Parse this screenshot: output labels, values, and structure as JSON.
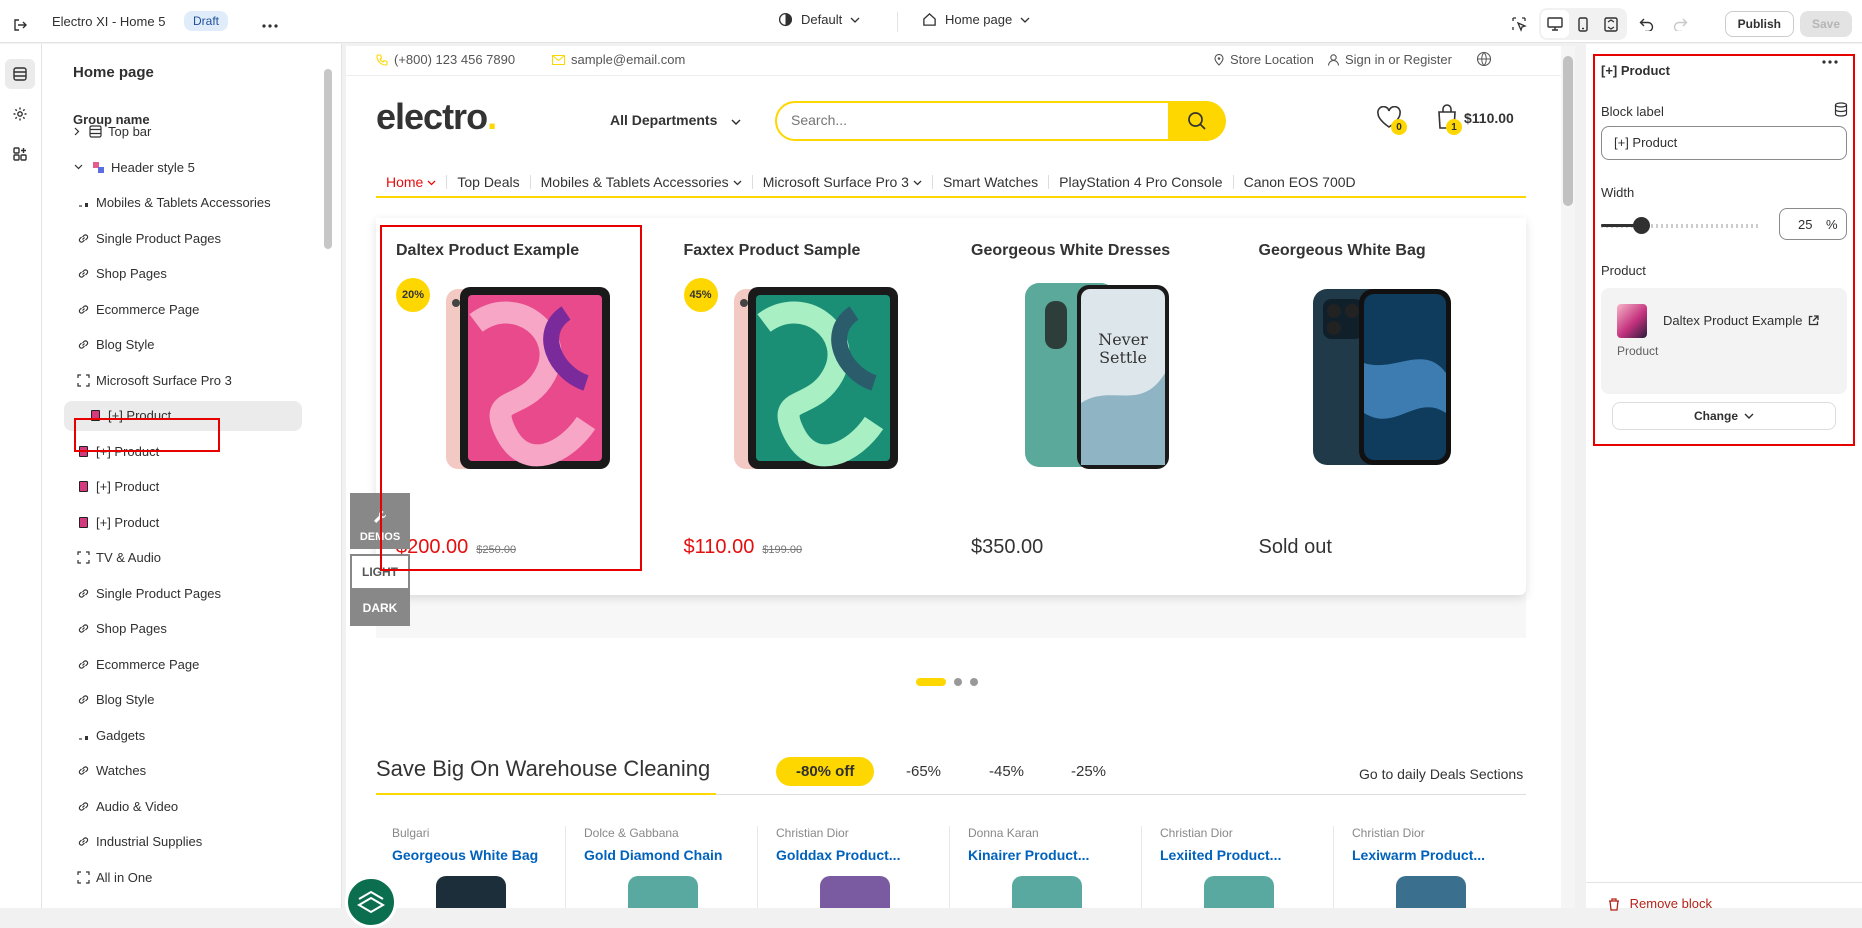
{
  "topbar": {
    "title": "Electro XI - Home 5",
    "status_badge": "Draft",
    "theme_selector": "Default",
    "page_selector": "Home page",
    "publish_label": "Publish",
    "save_label": "Save"
  },
  "sidebar": {
    "title": "Home page",
    "group_label": "Group name",
    "items": [
      {
        "label": "Top bar",
        "icon": "layout-icon",
        "level": 0
      },
      {
        "label": "Header style 5",
        "icon": "image-thumb-icon",
        "level": 0
      },
      {
        "label": "Mobiles & Tablets Accessories",
        "icon": "small-image-icon",
        "level": 1
      },
      {
        "label": "Single Product Pages",
        "icon": "link-icon",
        "level": 1
      },
      {
        "label": "Shop Pages",
        "icon": "link-icon",
        "level": 1
      },
      {
        "label": "Ecommerce Page",
        "icon": "link-icon",
        "level": 1
      },
      {
        "label": "Blog Style",
        "icon": "link-icon",
        "level": 1
      },
      {
        "label": "Microsoft Surface Pro 3",
        "icon": "frame-icon",
        "level": 1
      },
      {
        "label": "[+] Product",
        "icon": "product-thumb-icon",
        "level": 1,
        "selected": true
      },
      {
        "label": "[+] Product",
        "icon": "product-thumb-icon",
        "level": 1
      },
      {
        "label": "[+] Product",
        "icon": "product-thumb-icon",
        "level": 1
      },
      {
        "label": "[+] Product",
        "icon": "product-thumb-icon",
        "level": 1
      },
      {
        "label": "TV & Audio",
        "icon": "frame-icon",
        "level": 1
      },
      {
        "label": "Single Product Pages",
        "icon": "link-icon",
        "level": 1
      },
      {
        "label": "Shop Pages",
        "icon": "link-icon",
        "level": 1
      },
      {
        "label": "Ecommerce Page",
        "icon": "link-icon",
        "level": 1
      },
      {
        "label": "Blog Style",
        "icon": "link-icon",
        "level": 1
      },
      {
        "label": "Gadgets",
        "icon": "small-image-icon",
        "level": 1
      },
      {
        "label": "Watches",
        "icon": "link-icon",
        "level": 1
      },
      {
        "label": "Audio & Video",
        "icon": "link-icon",
        "level": 1
      },
      {
        "label": "Industrial Supplies",
        "icon": "link-icon",
        "level": 1
      },
      {
        "label": "All in One",
        "icon": "frame-icon",
        "level": 1
      }
    ]
  },
  "store": {
    "phone": "(+800) 123 456 7890",
    "email": "sample@email.com",
    "store_location": "Store Location",
    "sign_in": "Sign in or Register",
    "brand": "electro",
    "brand_dot": ".",
    "departments": "All Departments",
    "search_placeholder": "Search...",
    "wishlist_count": "0",
    "cart_count": "1",
    "cart_total": "$110.00",
    "nav": [
      "Home",
      "Top Deals",
      "Mobiles & Tablets Accessories",
      "Microsoft Surface Pro 3",
      "Smart Watches",
      "PlayStation 4 Pro Console",
      "Canon EOS 700D"
    ],
    "products": [
      {
        "name": "Daltex Product Example",
        "discount": "20%",
        "price": "$200.00",
        "old_price": "$250.00"
      },
      {
        "name": "Faxtex Product Sample",
        "discount": "45%",
        "price": "$110.00",
        "old_price": "$199.00"
      },
      {
        "name": "Georgeous White Dresses",
        "discount": "",
        "price": "$350.00",
        "old_price": ""
      },
      {
        "name": "Georgeous White Bag",
        "discount": "",
        "price": "Sold out",
        "old_price": ""
      }
    ],
    "phone_screen_text": "Never Settle",
    "demos_label": "DEMOS",
    "light_label": "LIGHT",
    "dark_label": "DARK",
    "section_title": "Save Big On Warehouse Cleaning",
    "offers": [
      "-80% off",
      "-65%",
      "-45%",
      "-25%"
    ],
    "daily_link": "Go to daily Deals Sections",
    "deals": [
      {
        "brand": "Bulgari",
        "name": "Georgeous White Bag"
      },
      {
        "brand": "Dolce & Gabbana",
        "name": "Gold Diamond Chain"
      },
      {
        "brand": "Christian Dior",
        "name": "Golddax Product..."
      },
      {
        "brand": "Donna Karan",
        "name": "Kinairer Product..."
      },
      {
        "brand": "Christian Dior",
        "name": "Lexiited Product..."
      },
      {
        "brand": "Christian Dior",
        "name": "Lexiwarm Product..."
      }
    ]
  },
  "settings": {
    "title": "[+] Product",
    "block_label_heading": "Block label",
    "block_label_value": "[+] Product",
    "width_heading": "Width",
    "width_value": "25",
    "width_unit": "%",
    "width_fraction": 0.25,
    "product_heading": "Product",
    "product_name": "Daltex Product Example",
    "product_sub": "Product",
    "change_label": "Change",
    "remove_label": "Remove block"
  },
  "colors": {
    "accent_yellow": "#fed700",
    "sale_red": "#e30f0f",
    "highlight_red": "#e60000",
    "link_blue": "#0062bd"
  }
}
